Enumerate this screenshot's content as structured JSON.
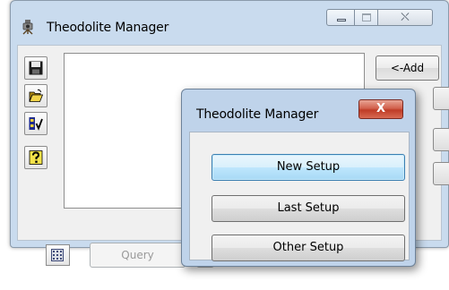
{
  "main_window": {
    "title": "Theodolite Manager",
    "caption_buttons": {
      "close_glyph": "⛌"
    },
    "add_button": "<-Add",
    "query_button": "Query",
    "toolbar_icons": [
      "save-icon",
      "open-folder-icon",
      "checklist-icon",
      "help-icon",
      "calculator-icon"
    ]
  },
  "dialog": {
    "title": "Theodolite Manager",
    "close_glyph": "X",
    "buttons": [
      "New Setup",
      "Last Setup",
      "Other Setup"
    ],
    "default_button": "New Setup"
  }
}
